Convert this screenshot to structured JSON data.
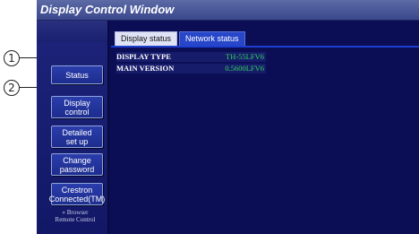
{
  "window": {
    "title": "Display Control Window"
  },
  "callouts": [
    "1",
    "2"
  ],
  "tabs": [
    {
      "label": "Display status",
      "active": true
    },
    {
      "label": "Network status",
      "active": false
    }
  ],
  "display_status": {
    "rows": [
      {
        "key": "DISPLAY TYPE",
        "value": "TH-55LFV6"
      },
      {
        "key": "MAIN VERSION",
        "value": "0.5600LFV6"
      }
    ]
  },
  "sidebar": {
    "items": [
      {
        "label": "Status"
      },
      {
        "label_line1": "Display",
        "label_line2": "control"
      },
      {
        "label_line1": "Detailed",
        "label_line2": "set up"
      },
      {
        "label_line1": "Change",
        "label_line2": "password"
      },
      {
        "label_line1": "Crestron",
        "label_line2": "Connected(TM)"
      }
    ],
    "browser_remote": {
      "line1": "» Browser",
      "line2": "Remote Control"
    }
  },
  "colors": {
    "window_bg": "#0b0e55",
    "accent_blue": "#2746c9",
    "value_green": "#2fd35a"
  }
}
